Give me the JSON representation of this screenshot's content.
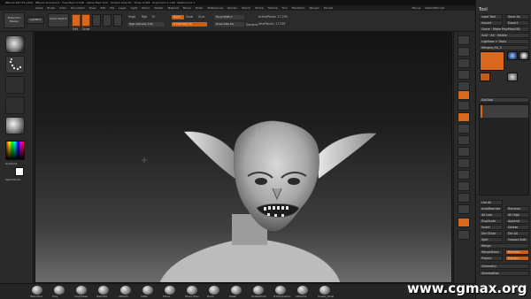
{
  "titlebar": {
    "text": "ZBrush 4R7 P3 (x64) · ZBrush Document · Free Mem 3.7GB · Active Mem 612 · Scratch Disk 50 · Timer 0.018 · PolyCount 2.1 KP · MeshCount 1",
    "right": "QuickSave",
    "right_highlight": "Default2sided"
  },
  "menu": {
    "items": [
      "Alpha",
      "Brush",
      "Color",
      "Document",
      "Draw",
      "Edit",
      "File",
      "Layer",
      "Light",
      "Macro",
      "Marker",
      "Material",
      "Movie",
      "Picker",
      "Preferences",
      "Render",
      "Stencil",
      "Stroke",
      "Texture",
      "Tool",
      "Transform",
      "Zplugin",
      "Zscript"
    ],
    "right_items": [
      "Menus",
      "DefaultZScript"
    ]
  },
  "toolbar": {
    "projection_master": "Projection Master",
    "lightbox": "LightBox",
    "quick_sketch": "Quick Sketch",
    "edit": "Edit",
    "draw": "Draw",
    "move": "Move",
    "scale": "Scale",
    "rotate": "Rotate",
    "mrgb": "Mrgb",
    "rgb": "Rgb",
    "m": "M",
    "zadd": "Zadd",
    "zsub": "Zsub",
    "zcut": "Zcut",
    "focal_shift_label": "Focal Shift",
    "focal_shift_value": "0",
    "draw_size_label": "Draw Size",
    "draw_size_value": "64",
    "z_intensity_label": "Z Intensity",
    "z_intensity_value": "25",
    "rgb_intensity_label": "Rgb Intensity",
    "rgb_intensity_value": "100",
    "dynamic": "Dynamic",
    "active_points_label": "ActivePoints:",
    "active_points_value": "17,239",
    "total_points_label": "TotalPoints:",
    "total_points_value": "17,239"
  },
  "left_shelf": {
    "gradient_label": "Gradient",
    "switch_color_label": "SwitchColor"
  },
  "tray": {
    "title": "Tool",
    "load_tool": "Load Tool",
    "save_as": "Save As",
    "import": "Import",
    "export": "Export",
    "clone": "Clone",
    "make_polymesh": "Make PolyMesh3D",
    "goz": "GoZ",
    "all": "All",
    "visible": "Visible",
    "lightbox_tools": "Lightbox > Tools",
    "tool_name": "Merged_SK_3",
    "subtool": "SubTool",
    "list_all": "List All",
    "rename": "Rename",
    "autoreorder": "AutoReorder",
    "all_low": "All Low",
    "all_high": "All High",
    "duplicate": "Duplicate",
    "append": "Append",
    "insert": "Insert",
    "delete": "Delete",
    "del_other": "Del Other",
    "del_all": "Del All",
    "split": "Split",
    "merge": "Merge",
    "groups_split": "Groups Split",
    "remesh": "Remesh",
    "merge_down": "MergeDown",
    "project": "Project",
    "extract": "Extract",
    "geometry": "Geometry",
    "shadowbox": "ShadowBox"
  },
  "bottom_brushes": [
    "Standard",
    "Clay",
    "ClayTubes",
    "DamStd",
    "hPolish",
    "Inflat",
    "Move",
    "Move Topo",
    "Pinch",
    "Slash",
    "SnakeHook",
    "TrimDynamic",
    "hPolish2",
    "Snake_Hook"
  ],
  "watermark": "www.cgmax.org",
  "colors": {
    "accent": "#d9681f",
    "background": "#262626",
    "viewport_bottom": "#6b6b6b"
  }
}
